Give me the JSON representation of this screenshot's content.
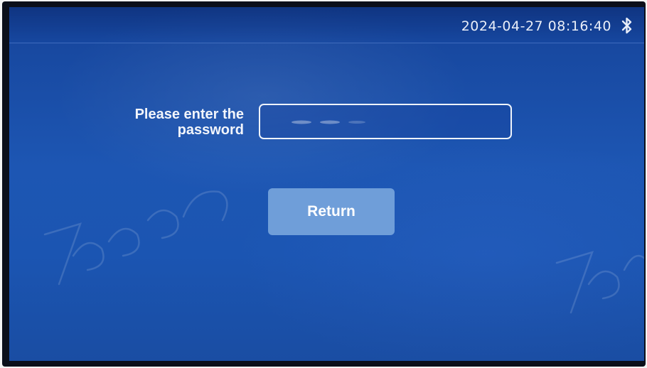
{
  "status_bar": {
    "datetime": "2024-04-27 08:16:40",
    "bluetooth_icon": "bluetooth-icon"
  },
  "password_form": {
    "label_line1": "Please enter the",
    "label_line2": "password",
    "input_value": ""
  },
  "return_button": {
    "label": "Return"
  },
  "watermark": {
    "text": "Joboon",
    "note_icon": "watermark-logo"
  },
  "colors": {
    "screen_blue": "#1d56b3",
    "button_fill": "#6f9ed9",
    "text_light": "#f2f5fb"
  }
}
